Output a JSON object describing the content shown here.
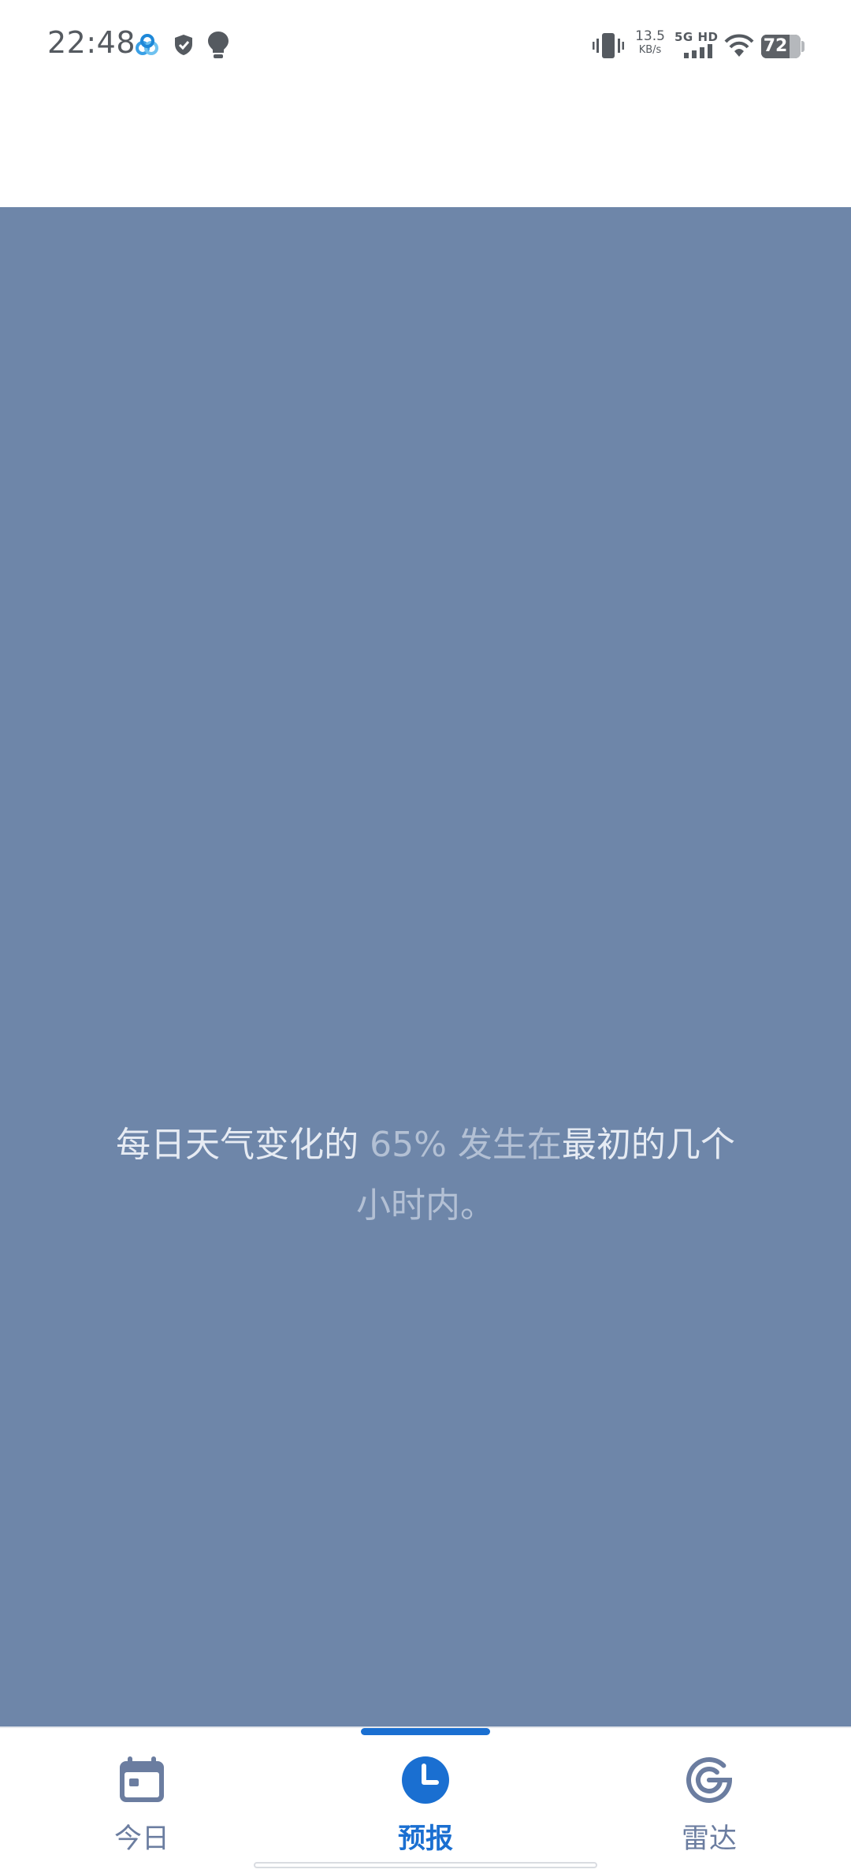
{
  "status_bar": {
    "time": "22:48",
    "net_speed_value": "13.5",
    "net_speed_unit": "KB/s",
    "network_label": "5G HD",
    "battery_level": "72",
    "battery_fraction": 0.72,
    "icons": [
      "cloud-app-icon",
      "shield-icon",
      "lightbulb-icon",
      "vibrate-icon",
      "signal-icon",
      "wifi-icon",
      "battery-icon"
    ]
  },
  "tip": {
    "text_part1": "每日天气变化的 ",
    "text_part2": "65% 发生在",
    "text_part3": "最初的几个",
    "text_part4": "小时内。"
  },
  "colors": {
    "tip_background": "#6e86a9",
    "accent": "#1a6fd1",
    "nav_inactive": "#6b7da0"
  },
  "bottom_nav": {
    "active_index": 1,
    "items": [
      {
        "label": "今日",
        "icon": "calendar-icon"
      },
      {
        "label": "预报",
        "icon": "clock-icon"
      },
      {
        "label": "雷达",
        "icon": "radar-icon"
      }
    ]
  }
}
